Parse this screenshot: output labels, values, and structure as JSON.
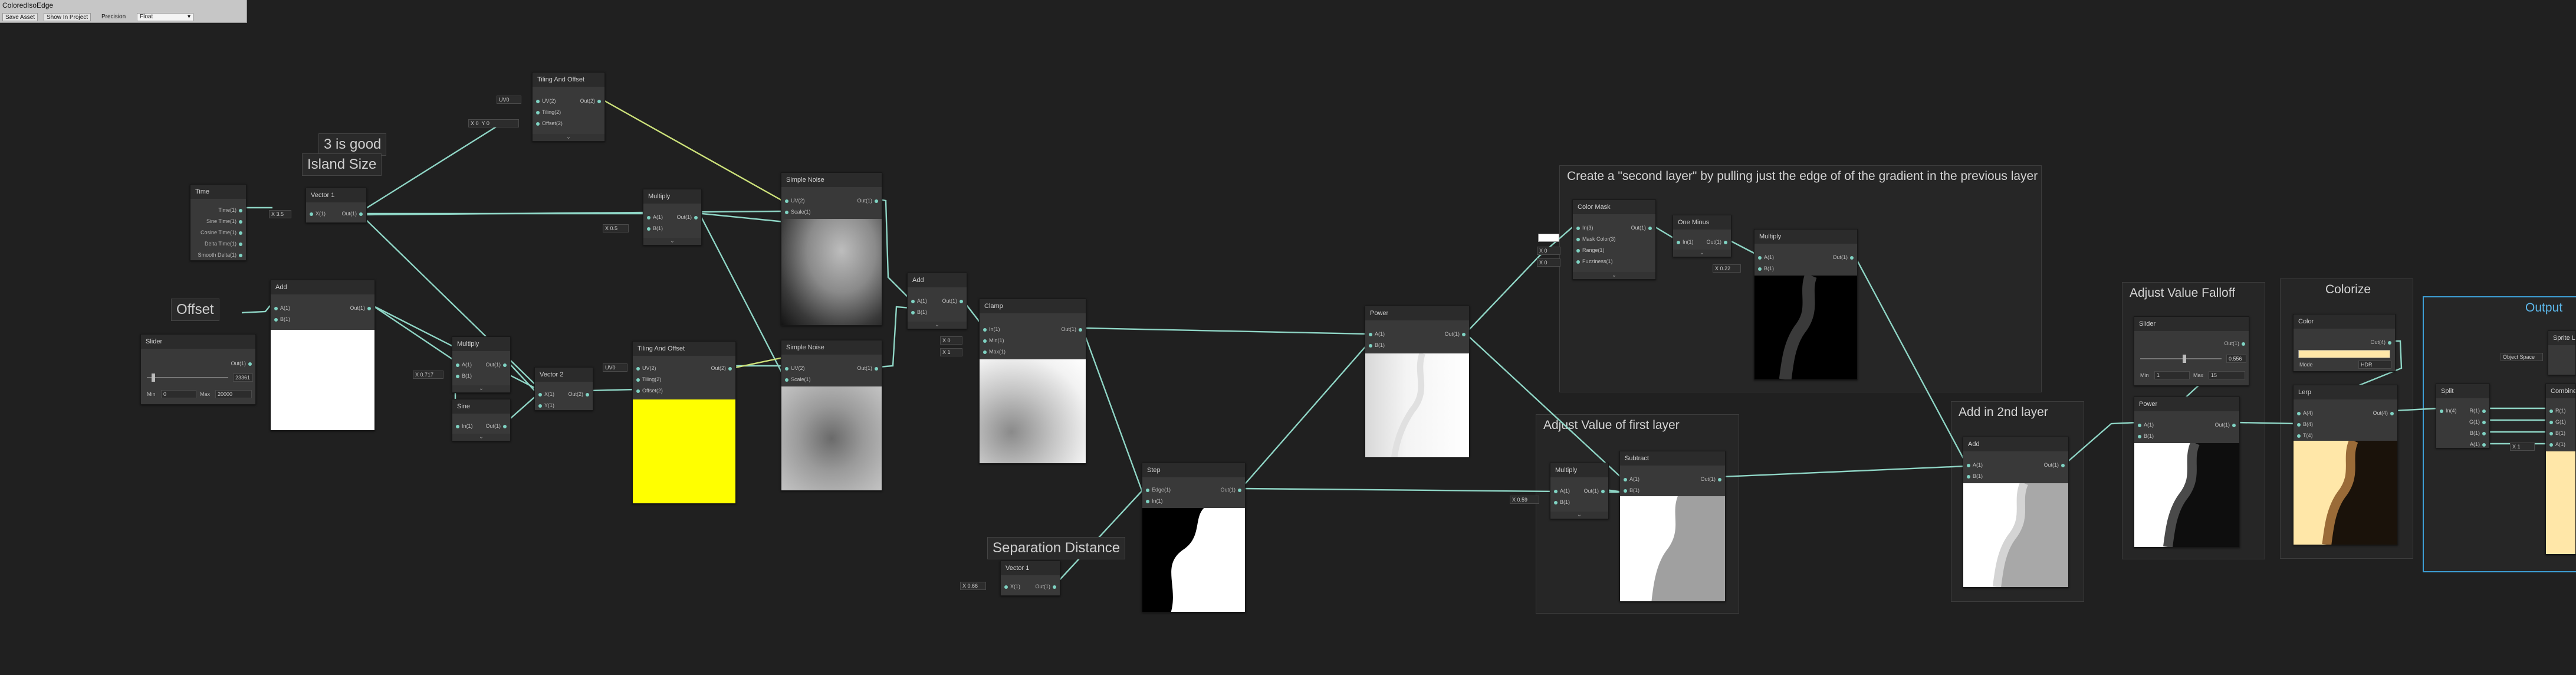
{
  "toolbar": {
    "title": "ColoredIsoEdge",
    "save_label": "Save Asset",
    "show_project_label": "Show In Project",
    "precision_label": "Precision",
    "precision_value": "Float"
  },
  "groups": {
    "second_layer": "Create a \"second layer\" by pulling just the edge of of the gradient in the previous layer",
    "adjust_first": "Adjust Value of first layer",
    "add_second": "Add in 2nd layer",
    "falloff": "Adjust Value Falloff",
    "colorize": "Colorize",
    "output": "Output"
  },
  "stickies": {
    "good": "3 is good",
    "island": "Island Size",
    "offset": "Offset",
    "separation": "Separation Distance"
  },
  "nodes": {
    "time": {
      "title": "Time",
      "ports": [
        "Time(1)",
        "Sine Time(1)",
        "Cosine Time(1)",
        "Delta Time(1)",
        "Smooth Delta(1)"
      ]
    },
    "vector1_island": {
      "title": "Vector 1",
      "in": "X(1)",
      "out": "Out(1)",
      "value": "3.5"
    },
    "tiling_top": {
      "title": "Tiling And Offset",
      "ports_in": [
        "UV(2)",
        "Tiling(2)",
        "Offset(2)"
      ],
      "out": "Out(2)",
      "uv_field": "UV0",
      "offset_field": "0"
    },
    "multiply_top": {
      "title": "Multiply",
      "a": "A(1)",
      "b": "B(1)",
      "out": "Out(1)",
      "b_field": "0.5"
    },
    "add_left": {
      "title": "Add",
      "a": "A(1)",
      "b": "B(1)",
      "out": "Out(1)"
    },
    "slider": {
      "title": "Slider",
      "out": "Out(1)",
      "value": "23361",
      "min_label": "Min",
      "min": "0",
      "max_label": "Max",
      "max": "20000"
    },
    "multiply_mid": {
      "title": "Multiply",
      "a": "A(1)",
      "b": "B(1)",
      "out": "Out(1)",
      "b_field": "0.717"
    },
    "sine": {
      "title": "Sine",
      "in": "In(1)",
      "out": "Out(1)"
    },
    "vector2": {
      "title": "Vector 2",
      "x": "X(1)",
      "y": "Y(1)",
      "out": "Out(2)"
    },
    "tiling_bottom": {
      "title": "Tiling And Offset",
      "ports_in": [
        "UV(2)",
        "Tiling(2)",
        "Offset(2)"
      ],
      "out": "Out(2)",
      "uv_field": "UV0"
    },
    "noise_top": {
      "title": "Simple Noise",
      "uv": "UV(2)",
      "scale": "Scale(1)",
      "out": "Out(1)"
    },
    "noise_bottom": {
      "title": "Simple Noise",
      "uv": "UV(2)",
      "scale": "Scale(1)",
      "out": "Out(1)"
    },
    "add_mid": {
      "title": "Add",
      "a": "A(1)",
      "b": "B(1)",
      "out": "Out(1)"
    },
    "clamp": {
      "title": "Clamp",
      "in": "In(1)",
      "min": "Min(1)",
      "max": "Max(1)",
      "out": "Out(1)",
      "min_field": "0",
      "max_field": "1"
    },
    "step": {
      "title": "Step",
      "edge": "Edge(1)",
      "in": "In(1)",
      "out": "Out(1)"
    },
    "vector1_sep": {
      "title": "Vector 1",
      "in": "X(1)",
      "out": "Out(1)",
      "value": "0.66"
    },
    "power_mid": {
      "title": "Power",
      "a": "A(1)",
      "b": "B(1)",
      "out": "Out(1)"
    },
    "color_mask": {
      "title": "Color Mask",
      "ports_in": [
        "In(3)",
        "Mask Color(3)",
        "Range(1)",
        "Fuzziness(1)"
      ],
      "out": "Out(1)",
      "range_field": "0",
      "fuzz_field": "0"
    },
    "one_minus": {
      "title": "One Minus",
      "in": "In(1)",
      "out": "Out(1)"
    },
    "multiply_right": {
      "title": "Multiply",
      "a": "A(1)",
      "b": "B(1)",
      "out": "Out(1)",
      "b_field": "0.22"
    },
    "multiply_first": {
      "title": "Multiply",
      "a": "A(1)",
      "b": "B(1)",
      "out": "Out(1)",
      "a_field": "0.59"
    },
    "subtract": {
      "title": "Subtract",
      "a": "A(1)",
      "b": "B(1)",
      "out": "Out(1)"
    },
    "add_2nd": {
      "title": "Add",
      "a": "A(1)",
      "b": "B(1)",
      "out": "Out(1)"
    },
    "slider_falloff": {
      "title": "Slider",
      "out": "Out(1)",
      "value": "0.556",
      "min_label": "Min",
      "min": "1",
      "max_label": "Max",
      "max": "15"
    },
    "power_falloff": {
      "title": "Power",
      "a": "A(1)",
      "b": "B(1)",
      "out": "Out(1)"
    },
    "color": {
      "title": "Color",
      "out": "Out(4)",
      "mode_label": "Mode",
      "mode": "HDR"
    },
    "lerp": {
      "title": "Lerp",
      "a": "A(4)",
      "b": "B(4)",
      "t": "T(4)",
      "out": "Out(4)"
    },
    "split": {
      "title": "Split",
      "in": "In(4)",
      "r": "R(1)",
      "g": "G(1)",
      "b": "B(1)",
      "a": "A(1)"
    },
    "combine": {
      "title": "Combine",
      "r": "R(1)",
      "g": "G(1)",
      "b": "B(1)",
      "a": "A(1)",
      "a_field": "1"
    },
    "sprite": {
      "title": "Sprite Lit Master",
      "space": "Object Space"
    }
  },
  "colors": {
    "wire": "#8fd6c6",
    "wire_yellow": "#cde27a",
    "accent_blue": "#3d9fd6",
    "swatch_yellow": "#ffff00"
  }
}
